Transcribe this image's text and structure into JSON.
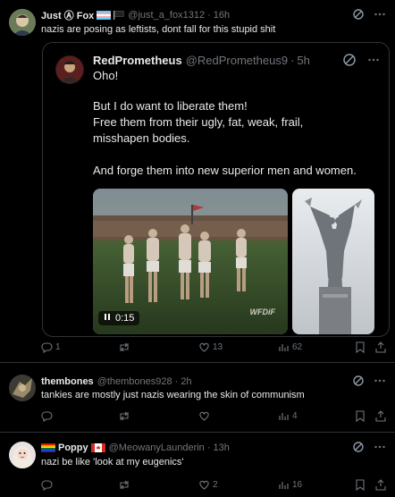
{
  "post1": {
    "name": "Just Ⓐ Fox",
    "handle": "@just_a_fox1312",
    "time": "16h",
    "text": "nazis are posing as leftists, dont fall for this stupid shit",
    "quote": {
      "name": "RedPrometheus",
      "handle": "@RedPrometheus9",
      "time": "5h",
      "lines": [
        "Oho!",
        "But I do want to liberate them!",
        "Free them from their ugly, fat, weak, frail,",
        "misshapen bodies.",
        "And forge them into new superior men and women."
      ],
      "video_time": "0:15",
      "video_watermark": "WFDiF"
    },
    "actions": {
      "replies": "1",
      "reposts": "",
      "likes": "13",
      "views": "62"
    }
  },
  "post2": {
    "name": "thembones",
    "handle": "@thembones928",
    "time": "2h",
    "text": "tankies are mostly just nazis wearing the skin of communism",
    "actions": {
      "replies": "",
      "reposts": "",
      "likes": "",
      "views": "4"
    }
  },
  "post3": {
    "name": "Poppy",
    "handle": "@MeowanyLaunderin",
    "time": "13h",
    "text": "nazi be like 'look at my eugenics'",
    "actions": {
      "replies": "",
      "reposts": "",
      "likes": "2",
      "views": "16"
    }
  },
  "separator": "·",
  "colors": {
    "background": "#000000",
    "text": "#e7e9ea",
    "muted": "#71767b",
    "border": "#2f3336",
    "grok_icon": "#8b98a5"
  },
  "icons": [
    "grok-icon",
    "more-icon",
    "reply-icon",
    "repost-icon",
    "like-icon",
    "views-icon",
    "bookmark-icon",
    "share-icon",
    "play-pause-icon"
  ]
}
